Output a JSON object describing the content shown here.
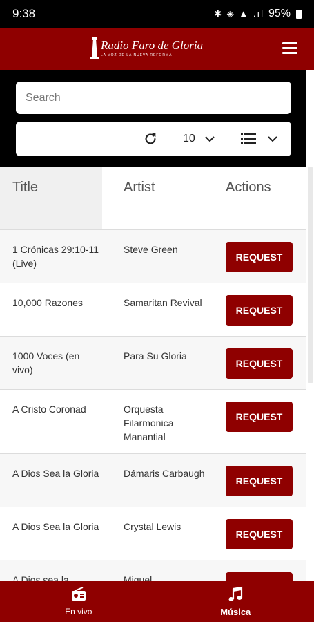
{
  "status_bar": {
    "time": "9:38",
    "icons": "✱ ◈ ▲ .ıl",
    "battery": "95%"
  },
  "header": {
    "logo_text": "Radio Faro de Gloria",
    "logo_subtitle": "LA VOZ DE LA NUEVA REFORMA",
    "menu_icon": "hamburger-menu-icon"
  },
  "search": {
    "placeholder": "Search",
    "value": ""
  },
  "controls": {
    "page_size": "10",
    "refresh_icon": "refresh-icon",
    "list_icon": "list-icon"
  },
  "table": {
    "headers": {
      "title": "Title",
      "artist": "Artist",
      "actions": "Actions"
    },
    "rows": [
      {
        "title": "1 Crónicas 29:10-11 (Live)",
        "artist": "Steve Green",
        "action": "REQUEST"
      },
      {
        "title": "10,000 Razones",
        "artist": "Samaritan Revival",
        "action": "REQUEST"
      },
      {
        "title": "1000 Voces (en vivo)",
        "artist": "Para Su Gloria",
        "action": "REQUEST"
      },
      {
        "title": "A Cristo Coronad",
        "artist": "Orquesta Filarmonica Manantial",
        "action": "REQUEST"
      },
      {
        "title": "A Dios Sea la Gloria",
        "artist": "Dámaris Carbaugh",
        "action": "REQUEST"
      },
      {
        "title": "A Dios Sea la Gloria",
        "artist": "Crystal Lewis",
        "action": "REQUEST"
      },
      {
        "title": "A Dios sea la",
        "artist": "Miguel",
        "action": "REQUEST"
      }
    ]
  },
  "bottom_nav": {
    "items": [
      {
        "label": "En vivo",
        "icon": "radio-icon"
      },
      {
        "label": "Música",
        "icon": "music-note-icon"
      }
    ]
  },
  "colors": {
    "brand": "#8f0000",
    "header_bg": "#000000"
  }
}
